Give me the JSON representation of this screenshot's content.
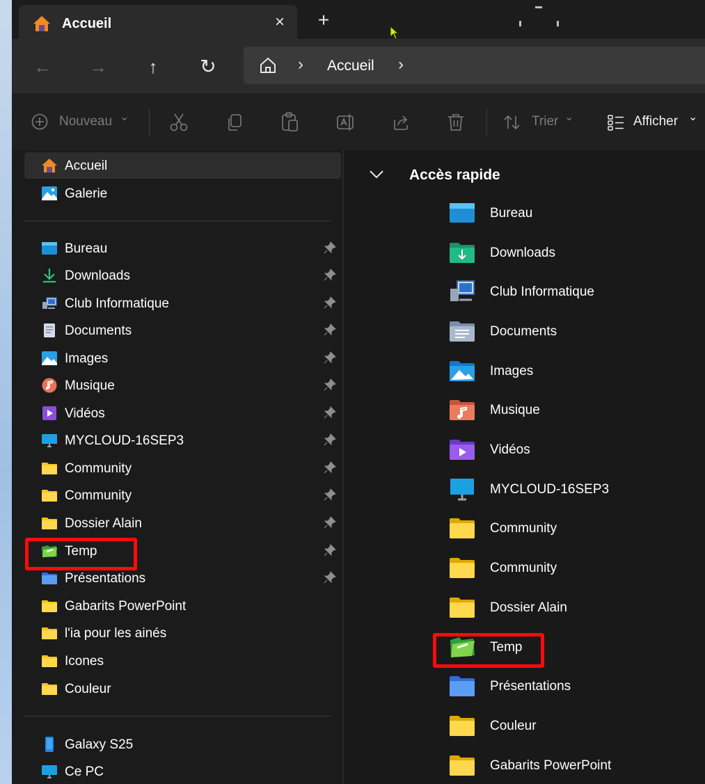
{
  "tab": {
    "title": "Accueil",
    "close": "×",
    "new_tab": "+"
  },
  "navigation": {
    "back": "←",
    "forward": "→",
    "up": "↑",
    "refresh": "↻"
  },
  "address": {
    "separator_1": "›",
    "location": "Accueil",
    "separator_2": "›"
  },
  "toolbar": {
    "new_label": "Nouveau",
    "sort_label": "Trier",
    "view_label": "Afficher",
    "caret": "⌄"
  },
  "sidebar": {
    "top_items": [
      {
        "label": "Accueil",
        "icon": "home-icon"
      },
      {
        "label": "Galerie",
        "icon": "gallery-icon"
      }
    ],
    "pinned_items": [
      {
        "label": "Bureau",
        "icon": "desktop-folder-icon",
        "pinned": true
      },
      {
        "label": "Downloads",
        "icon": "download-icon",
        "pinned": true
      },
      {
        "label": "Club Informatique",
        "icon": "network-computer-icon",
        "pinned": true
      },
      {
        "label": "Documents",
        "icon": "documents-icon",
        "pinned": true
      },
      {
        "label": "Images",
        "icon": "images-icon",
        "pinned": true
      },
      {
        "label": "Musique",
        "icon": "music-icon",
        "pinned": true
      },
      {
        "label": "Vidéos",
        "icon": "videos-icon",
        "pinned": true
      },
      {
        "label": "MYCLOUD-16SEP3",
        "icon": "monitor-icon",
        "pinned": true
      },
      {
        "label": "Community",
        "icon": "folder-icon",
        "pinned": true
      },
      {
        "label": "Community",
        "icon": "folder-icon",
        "pinned": true
      },
      {
        "label": "Dossier Alain",
        "icon": "folder-icon",
        "pinned": true
      },
      {
        "label": "Temp",
        "icon": "green-folder-icon",
        "pinned": true
      },
      {
        "label": "Présentations",
        "icon": "blue-folder-icon",
        "pinned": true
      },
      {
        "label": "Gabarits PowerPoint",
        "icon": "folder-icon",
        "pinned": false
      },
      {
        "label": "l'ia pour les ainés",
        "icon": "folder-icon",
        "pinned": false
      },
      {
        "label": "Icones",
        "icon": "folder-icon",
        "pinned": false
      },
      {
        "label": "Couleur",
        "icon": "folder-icon",
        "pinned": false
      }
    ],
    "device_items": [
      {
        "label": "Galaxy S25",
        "icon": "phone-icon"
      },
      {
        "label": "Ce PC",
        "icon": "pc-icon"
      }
    ]
  },
  "main": {
    "section_title": "Accès rapide",
    "items": [
      {
        "label": "Bureau",
        "icon": "desktop-folder-icon"
      },
      {
        "label": "Downloads",
        "icon": "downloads-folder-icon"
      },
      {
        "label": "Club Informatique",
        "icon": "network-computer-icon"
      },
      {
        "label": "Documents",
        "icon": "documents-folder-icon"
      },
      {
        "label": "Images",
        "icon": "images-folder-icon"
      },
      {
        "label": "Musique",
        "icon": "music-folder-icon"
      },
      {
        "label": "Vidéos",
        "icon": "videos-folder-icon"
      },
      {
        "label": "MYCLOUD-16SEP3",
        "icon": "monitor-icon"
      },
      {
        "label": "Community",
        "icon": "folder-icon"
      },
      {
        "label": "Community",
        "icon": "folder-icon"
      },
      {
        "label": "Dossier Alain",
        "icon": "folder-icon"
      },
      {
        "label": "Temp",
        "icon": "green-folder-icon"
      },
      {
        "label": "Présentations",
        "icon": "blue-folder-icon"
      },
      {
        "label": "Couleur",
        "icon": "folder-icon"
      },
      {
        "label": "Gabarits PowerPoint",
        "icon": "folder-icon"
      }
    ]
  },
  "colors": {
    "highlight": "#ff0a0a",
    "window_bg": "#191919",
    "folder_yellow": "#f5c518",
    "accent_blue": "#2aa0e6"
  }
}
